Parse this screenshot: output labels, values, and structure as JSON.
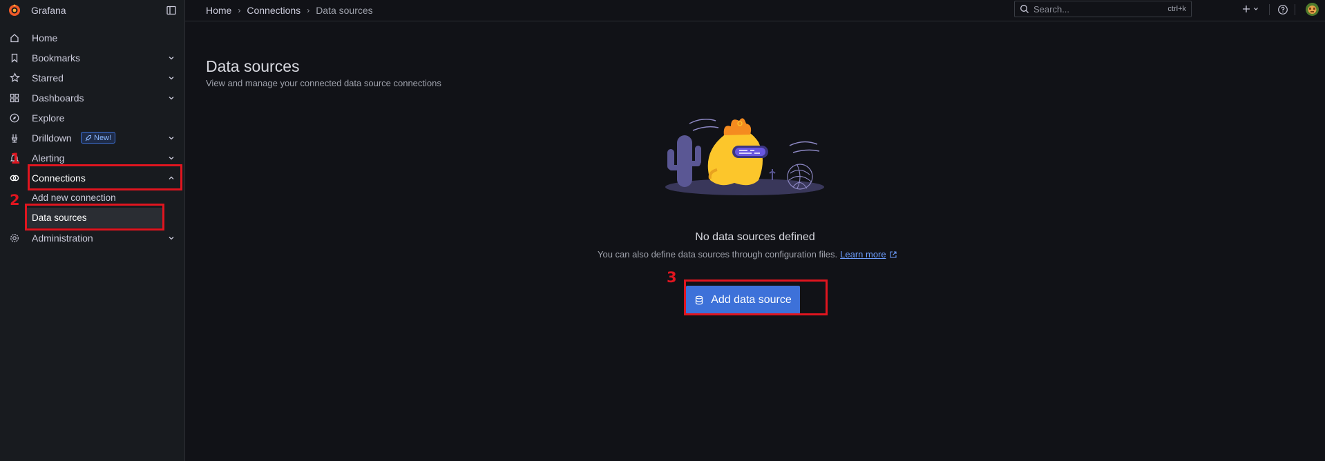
{
  "app": {
    "name": "Grafana"
  },
  "sidebar": {
    "items": [
      {
        "label": "Home",
        "icon": "home-icon",
        "expandable": false
      },
      {
        "label": "Bookmarks",
        "icon": "bookmark-icon",
        "expandable": true
      },
      {
        "label": "Starred",
        "icon": "star-icon",
        "expandable": true
      },
      {
        "label": "Dashboards",
        "icon": "apps-icon",
        "expandable": true
      },
      {
        "label": "Explore",
        "icon": "compass-icon",
        "expandable": false
      },
      {
        "label": "Drilldown",
        "icon": "drilldown-icon",
        "expandable": true,
        "badge": "New!"
      },
      {
        "label": "Alerting",
        "icon": "bell-icon",
        "expandable": true
      },
      {
        "label": "Connections",
        "icon": "link-icon",
        "expandable": true,
        "expanded": true
      },
      {
        "label": "Administration",
        "icon": "cog-icon",
        "expandable": true
      }
    ],
    "connections_children": [
      {
        "label": "Add new connection",
        "active": false
      },
      {
        "label": "Data sources",
        "active": true
      }
    ]
  },
  "annotations": [
    "1",
    "2",
    "3"
  ],
  "breadcrumb": [
    "Home",
    "Connections",
    "Data sources"
  ],
  "search": {
    "placeholder": "Search...",
    "shortcut": "ctrl+k"
  },
  "page": {
    "title": "Data sources",
    "subtitle": "View and manage your connected data source connections",
    "empty_title": "No data sources defined",
    "empty_desc": "You can also define data sources through configuration files.",
    "learn_more": "Learn more",
    "add_button": "Add data source"
  },
  "colors": {
    "accent": "#3d71d9",
    "annotation": "#e0151f",
    "bg": "#111217",
    "sidebar_bg": "#181b1f"
  }
}
